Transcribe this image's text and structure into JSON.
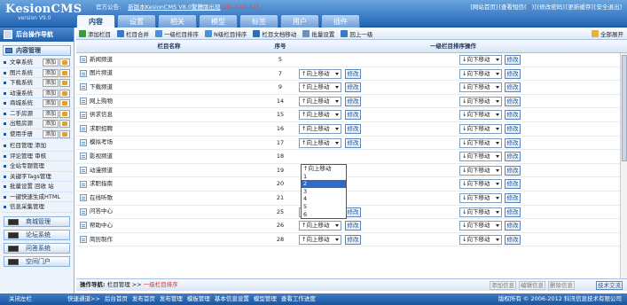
{
  "header": {
    "logo": "KesionCMS",
    "logo_version": "version V9.0",
    "notice_label": "官方公告:",
    "notice_link": "新版本KesionCMS V8.0繁體版出现",
    "notice_date": "[2012-10-31]",
    "top_links": [
      "[网站首页]",
      "[查看短信(",
      "0",
      ")]",
      "[修改密码]",
      "[更新缓存]",
      "[安全退出]"
    ]
  },
  "tabs": [
    "内容",
    "设置",
    "相关",
    "模型",
    "标签",
    "用户",
    "插件"
  ],
  "sidebar": {
    "title": "后台操作导航",
    "section": "内容管理",
    "systems": [
      {
        "label": "文章系统",
        "btn": "添加"
      },
      {
        "label": "图片系统",
        "btn": "添加"
      },
      {
        "label": "下载系统",
        "btn": "添加"
      },
      {
        "label": "动漫系统",
        "btn": "添加"
      },
      {
        "label": "商城系统",
        "btn": "添加"
      },
      {
        "label": "二手房源",
        "btn": "添加"
      },
      {
        "label": "出租房源",
        "btn": "添加"
      },
      {
        "label": "使用手册",
        "btn": "添加"
      }
    ],
    "links": [
      "栏目管理 添加",
      "评论管理 审核",
      "全站专题管理",
      "关键字Tags管理",
      "批量设置 回收 站",
      "一键快速生成HTML",
      "信息采集管理"
    ],
    "groups": [
      "商城管理",
      "论坛系统",
      "问答系统",
      "空间门户"
    ]
  },
  "toolbar": {
    "items": [
      {
        "label": "添加栏目",
        "color": "#3a9d3a"
      },
      {
        "label": "栏目合并",
        "color": "#3c78c4"
      },
      {
        "label": "一级栏目排序",
        "color": "#4f8fd8"
      },
      {
        "label": "N级栏目排序",
        "color": "#4f8fd8"
      },
      {
        "label": "栏目文档移动",
        "color": "#2d6fb9"
      },
      {
        "label": "批量设置",
        "color": "#6c8fc0"
      },
      {
        "label": "回上一级",
        "color": "#3c78c4"
      }
    ],
    "expand_all": "全部展开"
  },
  "grid": {
    "headers": [
      "栏目名称",
      "序号",
      "一级栏目排序操作"
    ],
    "up_label": "↑向上移动",
    "down_label": "↓向下移动",
    "edit_label": "修改",
    "rows": [
      {
        "name": "新闻频道",
        "order": "5",
        "up": false,
        "down": true
      },
      {
        "name": "图片频道",
        "order": "7",
        "up": true,
        "down": true
      },
      {
        "name": "下载频道",
        "order": "9",
        "up": true,
        "down": true
      },
      {
        "name": "网上购物",
        "order": "14",
        "up": true,
        "down": true
      },
      {
        "name": "供求信息",
        "order": "15",
        "up": true,
        "down": true
      },
      {
        "name": "求职招聘",
        "order": "16",
        "up": true,
        "down": true
      },
      {
        "name": "模拟考场",
        "order": "17",
        "up": true,
        "down": true
      },
      {
        "name": "影视频道",
        "order": "18",
        "up": false,
        "down": true
      },
      {
        "name": "动漫频道",
        "order": "19",
        "up": false,
        "down": true
      },
      {
        "name": "求职指南",
        "order": "20",
        "up": false,
        "down": true
      },
      {
        "name": "在线听歌",
        "order": "21",
        "up": false,
        "down": true
      },
      {
        "name": "问答中心",
        "order": "25",
        "up": true,
        "down": true
      },
      {
        "name": "帮助中心",
        "order": "26",
        "up": true,
        "down": true
      },
      {
        "name": "简历制作",
        "order": "28",
        "up": true,
        "down": true
      }
    ],
    "dropdown_options": [
      "↑向上移动",
      "1",
      "2",
      "3",
      "4",
      "5",
      "6"
    ],
    "dropdown_selected": "2"
  },
  "navbar": {
    "label": "操作导航:",
    "path1": "栏目管理",
    "sep": ">>",
    "path2": "一级栏目排序",
    "buttons": [
      "添加信息",
      "编辑信息",
      "删除信息",
      "技术交流"
    ]
  },
  "footer": {
    "left": "关闭左栏",
    "links": [
      "快速通道>>",
      "后台首页",
      "发布首页",
      "发布管理",
      "模板管理",
      "基本信息设置",
      "模型管理",
      "查看工作进度"
    ],
    "copyright": "版权所有 © 2006-2012 科汛信息技术有限公司"
  }
}
